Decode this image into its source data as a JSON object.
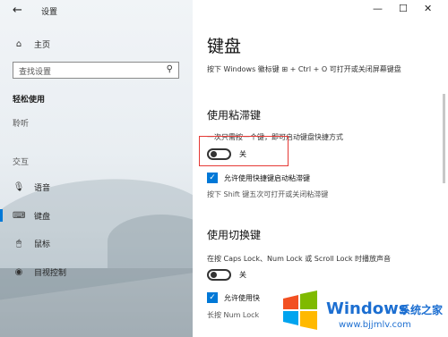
{
  "window": {
    "title": "设置",
    "back_icon": "←",
    "minimize": "—",
    "maximize": "☐",
    "close": "✕"
  },
  "sidebar": {
    "home": {
      "icon": "⌂",
      "label": "主页"
    },
    "search": {
      "placeholder": "查找设置",
      "icon": "⚲"
    },
    "group_title": "轻松使用",
    "section_listen": "聆听",
    "section_interaction": "交互",
    "items": [
      {
        "icon": "🎙",
        "label": "语音"
      },
      {
        "icon": "⌨",
        "label": "键盘"
      },
      {
        "icon": "🖱",
        "label": "鼠标"
      },
      {
        "icon": "◉",
        "label": "目视控制"
      }
    ]
  },
  "main": {
    "title": "键盘",
    "description": "按下 Windows 徽标键 ⊞ + Ctrl + O 可打开或关闭屏幕键盘",
    "sticky": {
      "heading": "使用粘滞键",
      "desc": "一次只需按一个键，即可启动键盘快捷方式",
      "toggle_state": "关",
      "checkbox_label": "允许使用快捷键启动粘滞键",
      "hint": "按下 Shift 键五次可打开或关闭粘滞键"
    },
    "toggle_keys": {
      "heading": "使用切换键",
      "desc": "在按 Caps Lock、Num Lock 或 Scroll Lock 时播放声音",
      "toggle_state": "关",
      "checkbox_label": "允许使用快",
      "hint": "长按 Num Lock"
    }
  },
  "watermark": {
    "brand": "Windows",
    "cn": "系统之家",
    "url": "www.bjjmlv.com"
  }
}
